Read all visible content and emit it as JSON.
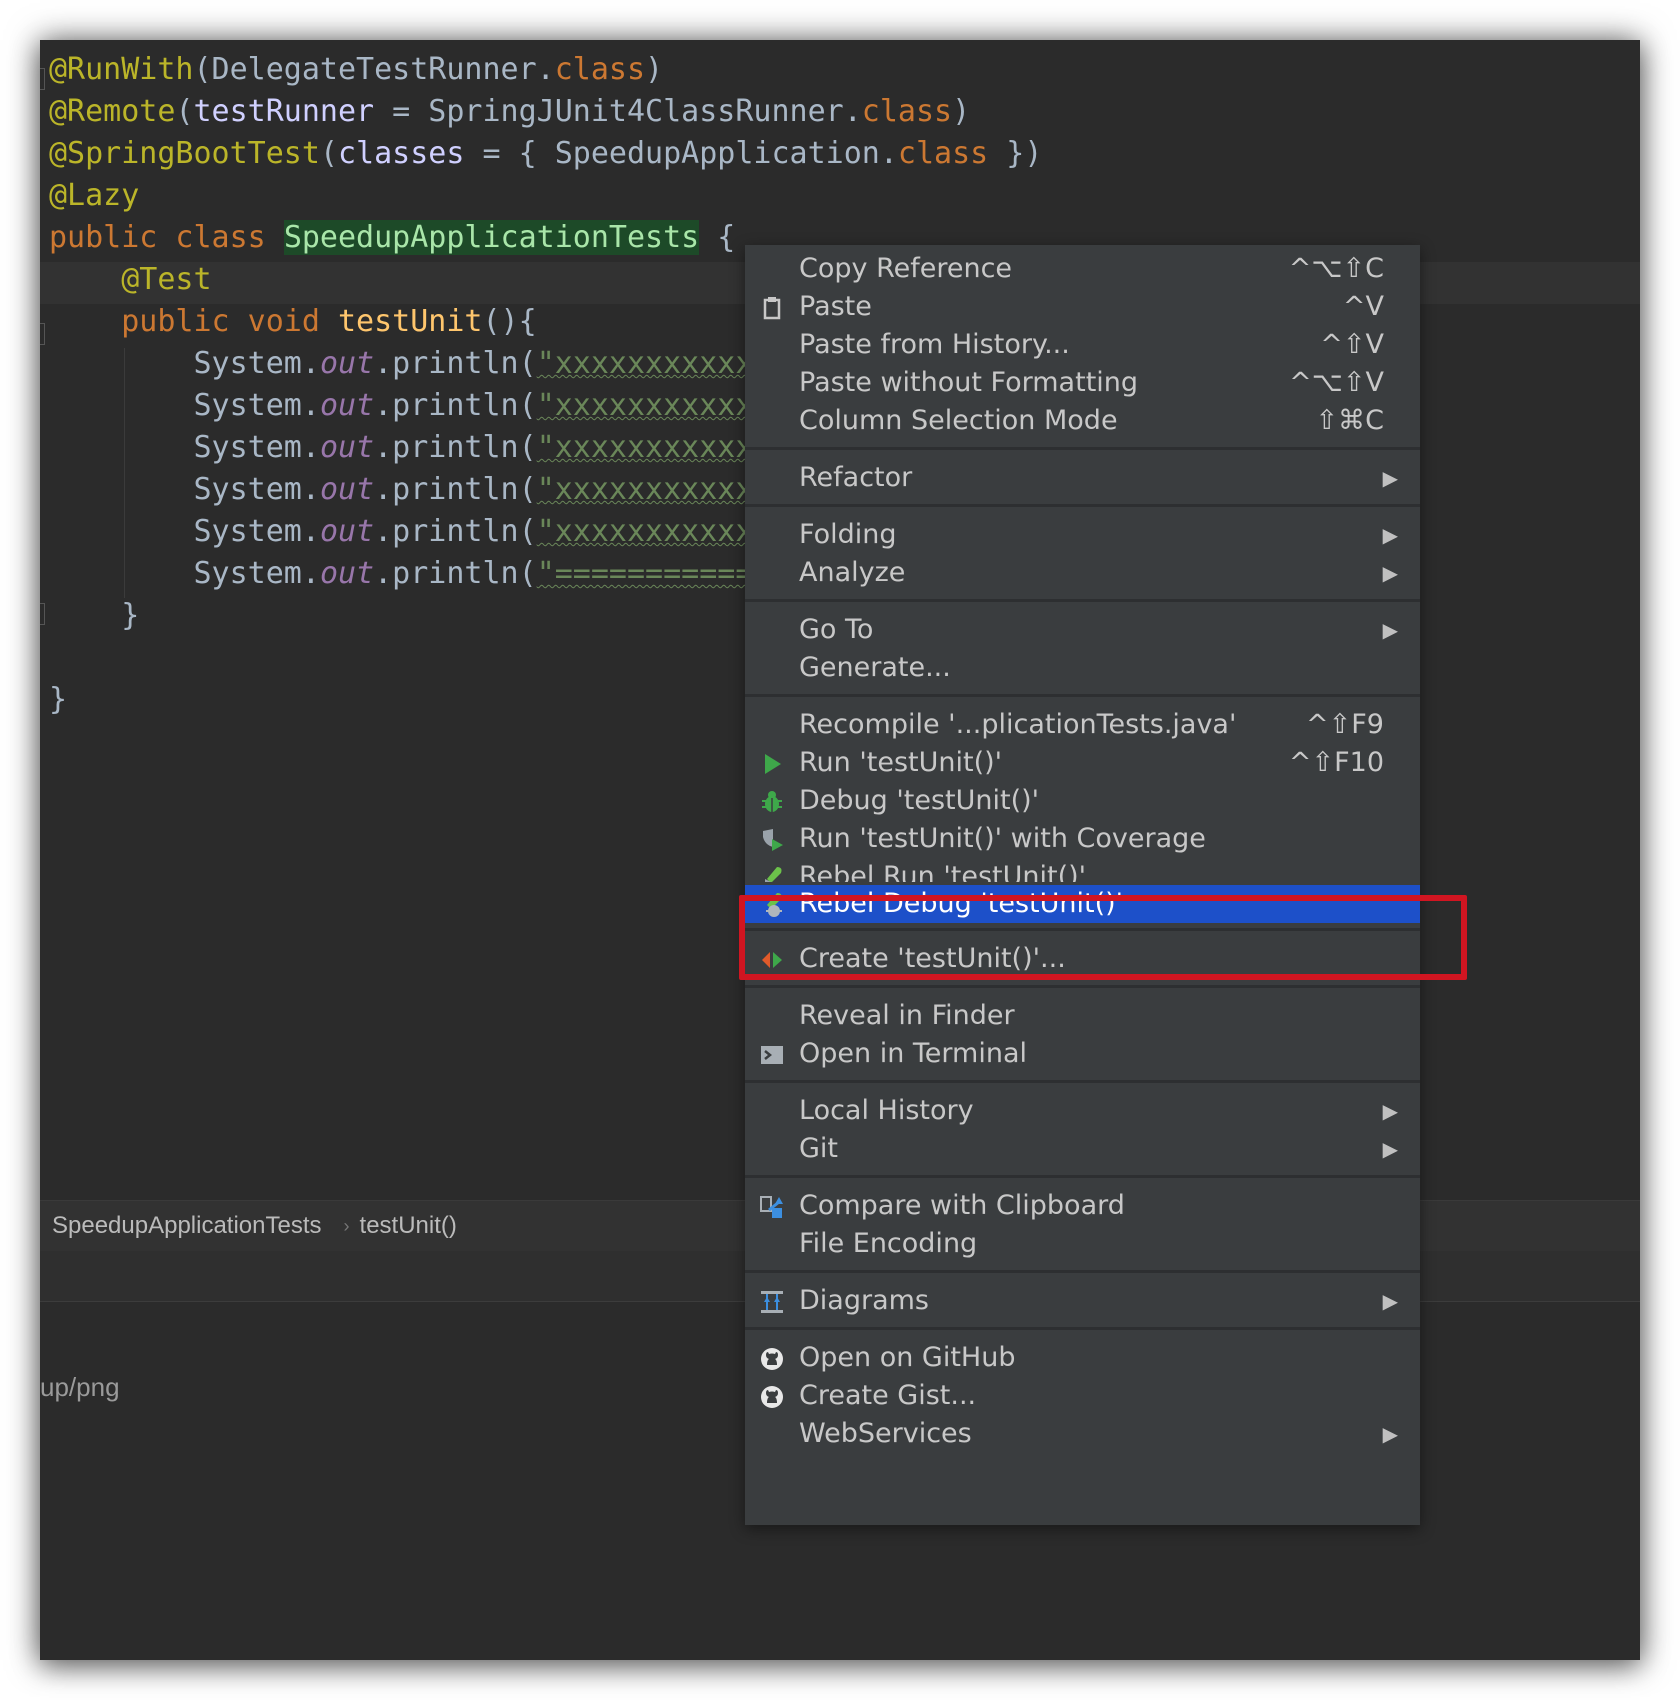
{
  "editor": {
    "lines": [
      {
        "parts": [
          {
            "t": "@RunWith",
            "c": "ann"
          },
          {
            "t": "(DelegateTestRunner.",
            "c": ""
          },
          {
            "t": "class",
            "c": "kw"
          },
          {
            "t": ")",
            "c": ""
          }
        ]
      },
      {
        "parts": [
          {
            "t": "@Remote",
            "c": "ann"
          },
          {
            "t": "(",
            "c": ""
          },
          {
            "t": "testRunner",
            "c": "param"
          },
          {
            "t": " = SpringJUnit4ClassRunner.",
            "c": ""
          },
          {
            "t": "class",
            "c": "kw"
          },
          {
            "t": ")",
            "c": ""
          }
        ]
      },
      {
        "parts": [
          {
            "t": "@SpringBootTest",
            "c": "ann"
          },
          {
            "t": "(",
            "c": ""
          },
          {
            "t": "classes",
            "c": "param"
          },
          {
            "t": " = { SpeedupApplication.",
            "c": ""
          },
          {
            "t": "class",
            "c": "kw"
          },
          {
            "t": " })",
            "c": ""
          }
        ]
      },
      {
        "parts": [
          {
            "t": "@Lazy",
            "c": "ann"
          }
        ]
      },
      {
        "parts": [
          {
            "t": "public class ",
            "c": "kw"
          },
          {
            "t": "SpeedupApplicationTests",
            "c": "classhl"
          },
          {
            "t": " {",
            "c": ""
          }
        ]
      },
      {
        "parts": [
          {
            "t": "    ",
            "c": ""
          },
          {
            "t": "@Test",
            "c": "ann"
          }
        ]
      },
      {
        "parts": [
          {
            "t": "    ",
            "c": ""
          },
          {
            "t": "public void ",
            "c": "kw"
          },
          {
            "t": "testUnit",
            "c": "fn"
          },
          {
            "t": "(){",
            "c": ""
          }
        ]
      },
      {
        "parts": [
          {
            "t": "        System.",
            "c": ""
          },
          {
            "t": "out",
            "c": "field"
          },
          {
            "t": ".println(",
            "c": ""
          },
          {
            "t": "\"xxxxxxxxxxxxx",
            "c": "str"
          }
        ]
      },
      {
        "parts": [
          {
            "t": "        System.",
            "c": ""
          },
          {
            "t": "out",
            "c": "field"
          },
          {
            "t": ".println(",
            "c": ""
          },
          {
            "t": "\"xxxxxxxxxxxxx",
            "c": "str"
          }
        ]
      },
      {
        "parts": [
          {
            "t": "        System.",
            "c": ""
          },
          {
            "t": "out",
            "c": "field"
          },
          {
            "t": ".println(",
            "c": ""
          },
          {
            "t": "\"xxxxxxxxxxxxx",
            "c": "str"
          }
        ]
      },
      {
        "parts": [
          {
            "t": "        System.",
            "c": ""
          },
          {
            "t": "out",
            "c": "field"
          },
          {
            "t": ".println(",
            "c": ""
          },
          {
            "t": "\"xxxxxxxxxxxxx",
            "c": "str"
          }
        ]
      },
      {
        "parts": [
          {
            "t": "        System.",
            "c": ""
          },
          {
            "t": "out",
            "c": "field"
          },
          {
            "t": ".println(",
            "c": ""
          },
          {
            "t": "\"xxxxxxxxxxxxx",
            "c": "str"
          }
        ]
      },
      {
        "parts": [
          {
            "t": "        System.",
            "c": ""
          },
          {
            "t": "out",
            "c": "field"
          },
          {
            "t": ".println(",
            "c": ""
          },
          {
            "t": "\"=============",
            "c": "str"
          }
        ]
      },
      {
        "parts": [
          {
            "t": "    }",
            "c": ""
          }
        ]
      },
      {
        "parts": [
          {
            "t": "",
            "c": ""
          }
        ]
      },
      {
        "parts": [
          {
            "t": "}",
            "c": ""
          }
        ]
      }
    ]
  },
  "breadcrumb": {
    "class_name": "SpeedupApplicationTests",
    "separator": "›",
    "method_name": "testUnit()"
  },
  "bottom_panel": {
    "path_text": "up/png"
  },
  "context_menu": {
    "items": [
      {
        "label": "Copy Reference",
        "shortcut": "^⌥⇧C",
        "icon": ""
      },
      {
        "label": "Paste",
        "shortcut": "^V",
        "icon": "clipboard-icon"
      },
      {
        "label": "Paste from History...",
        "shortcut": "^⇧V",
        "icon": ""
      },
      {
        "label": "Paste without Formatting",
        "shortcut": "^⌥⇧V",
        "icon": ""
      },
      {
        "label": "Column Selection Mode",
        "shortcut": "⇧⌘C",
        "icon": ""
      },
      {
        "sep": true
      },
      {
        "label": "Refactor",
        "submenu": true,
        "icon": ""
      },
      {
        "sep": true
      },
      {
        "label": "Folding",
        "submenu": true,
        "icon": ""
      },
      {
        "label": "Analyze",
        "submenu": true,
        "icon": ""
      },
      {
        "sep": true
      },
      {
        "label": "Go To",
        "submenu": true,
        "icon": ""
      },
      {
        "label": "Generate...",
        "icon": ""
      },
      {
        "sep": true
      },
      {
        "label": "Recompile '...plicationTests.java'",
        "shortcut": "^⇧F9",
        "icon": ""
      },
      {
        "label": "Run 'testUnit()'",
        "shortcut": "^⇧F10",
        "icon": "run-icon"
      },
      {
        "label": "Debug 'testUnit()'",
        "icon": "debug-bug-icon"
      },
      {
        "label": "Run 'testUnit()' with Coverage",
        "icon": "coverage-icon"
      },
      {
        "label": "Rebel Run 'testUnit()'",
        "icon": "rebel-run-icon",
        "clipped": true
      },
      {
        "label": "Rebel Debug 'testUnit()'",
        "icon": "rebel-debug-icon",
        "selected": true
      },
      {
        "sep": true
      },
      {
        "label": "Create 'testUnit()'...",
        "icon": "create-config-icon"
      },
      {
        "sep": true
      },
      {
        "label": "Reveal in Finder",
        "icon": ""
      },
      {
        "label": "Open in Terminal",
        "icon": "terminal-icon"
      },
      {
        "sep": true
      },
      {
        "label": "Local History",
        "submenu": true,
        "icon": ""
      },
      {
        "label": "Git",
        "submenu": true,
        "icon": ""
      },
      {
        "sep": true
      },
      {
        "label": "Compare with Clipboard",
        "icon": "compare-clipboard-icon"
      },
      {
        "label": "File Encoding",
        "icon": ""
      },
      {
        "sep": true
      },
      {
        "label": "Diagrams",
        "submenu": true,
        "icon": "diagram-icon"
      },
      {
        "sep": true
      },
      {
        "label": "Open on GitHub",
        "icon": "github-icon"
      },
      {
        "label": "Create Gist...",
        "icon": "github-icon"
      },
      {
        "label": "WebServices",
        "submenu": true,
        "icon": ""
      }
    ]
  },
  "colors": {
    "accent_selection": "#1d50c9",
    "highlight_box": "#d11521",
    "menu_bg": "#3a3d3f",
    "editor_bg": "#2b2b2b"
  }
}
